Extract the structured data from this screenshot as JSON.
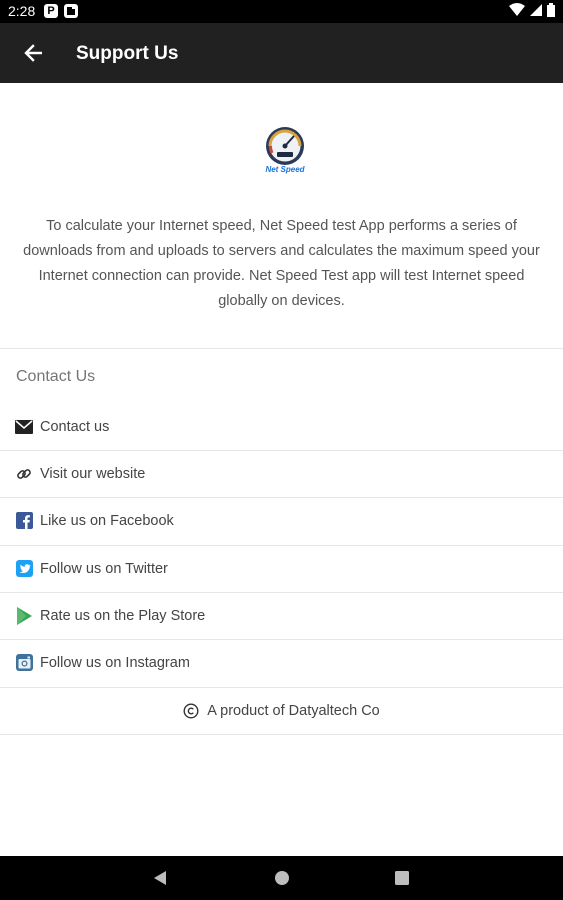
{
  "status_bar": {
    "time": "2:28",
    "icons": [
      "notification-p-icon",
      "notification-square-icon",
      "wifi-icon",
      "signal-icon",
      "battery-icon"
    ]
  },
  "app_bar": {
    "title": "Support Us",
    "back_icon": "arrow-left-icon",
    "background": "#212121"
  },
  "logo": {
    "caption": "Net Speed"
  },
  "description": "To calculate your Internet speed, Net Speed test App performs a series of downloads from and uploads to servers and calculates the maximum speed your Internet connection can provide. Net Speed Test app will test Internet speed globally on devices.",
  "contact_section": {
    "title": "Contact Us",
    "items": [
      {
        "label": "Contact us",
        "icon": "envelope-icon"
      },
      {
        "label": "Visit our website",
        "icon": "link-icon"
      },
      {
        "label": "Like us on Facebook",
        "icon": "facebook-icon",
        "color": "#3b5998"
      },
      {
        "label": "Follow us on Twitter",
        "icon": "twitter-icon",
        "color": "#1da1f2"
      },
      {
        "label": "Rate us on the Play Store",
        "icon": "play-store-icon",
        "color": "#34a853"
      },
      {
        "label": "Follow us on Instagram",
        "icon": "instagram-icon",
        "color": "#3f729b"
      }
    ]
  },
  "footer": {
    "text": "A product of Datyaltech Co",
    "icon": "copyright-icon"
  },
  "nav_bar": {
    "icons": [
      "back-triangle-icon",
      "home-circle-icon",
      "recents-square-icon"
    ]
  }
}
